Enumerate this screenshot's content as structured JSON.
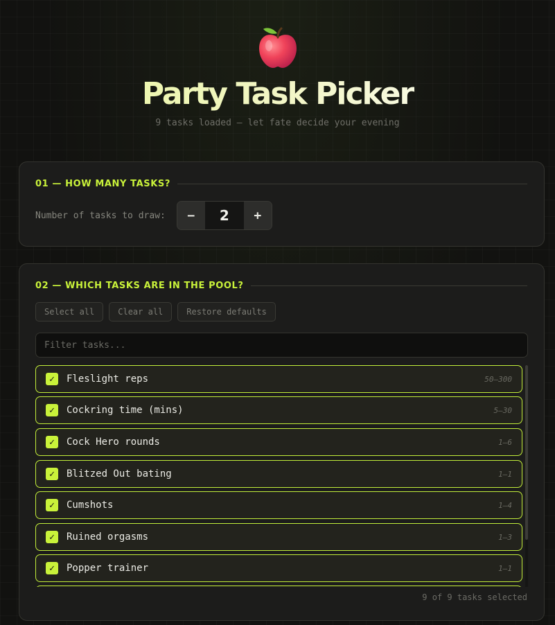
{
  "header": {
    "icon": "apple-icon",
    "title": "Party Task Picker",
    "subtitle": "9 tasks loaded — let fate decide your evening"
  },
  "section1": {
    "title": "01 — HOW MANY TASKS?",
    "label": "Number of tasks to draw:",
    "decrement_label": "−",
    "value": "2",
    "increment_label": "+"
  },
  "section2": {
    "title": "02 — WHICH TASKS ARE IN THE POOL?",
    "buttons": {
      "select_all": "Select all",
      "clear_all": "Clear all",
      "restore_defaults": "Restore defaults"
    },
    "filter_placeholder": "Filter tasks...",
    "check_glyph": "✓",
    "tasks": [
      {
        "name": "Fleslight reps",
        "range": "50–300",
        "checked": true
      },
      {
        "name": "Cockring time (mins)",
        "range": "5–30",
        "checked": true
      },
      {
        "name": "Cock Hero rounds",
        "range": "1–6",
        "checked": true
      },
      {
        "name": "Blitzed Out bating",
        "range": "1–1",
        "checked": true
      },
      {
        "name": "Cumshots",
        "range": "1–4",
        "checked": true
      },
      {
        "name": "Ruined orgasms",
        "range": "1–3",
        "checked": true
      },
      {
        "name": "Popper trainer",
        "range": "1–1",
        "checked": true
      }
    ],
    "count_text": "9 of 9 tasks selected"
  },
  "colors": {
    "accent": "#c9f23a",
    "background": "#121210",
    "card": "#1c1c1b"
  }
}
